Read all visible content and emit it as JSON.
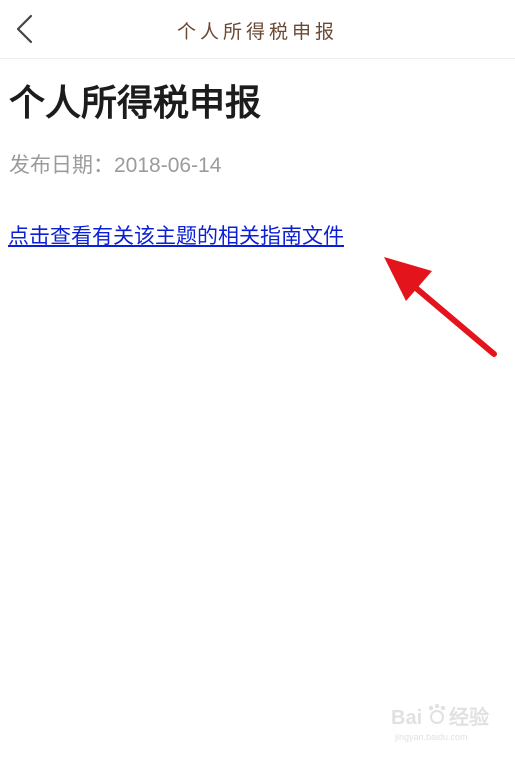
{
  "header": {
    "title": "个人所得税申报",
    "back_icon": "chevron-left-icon"
  },
  "article": {
    "title": "个人所得税申报",
    "date_label": "发布日期：",
    "date_value": "2018-06-14",
    "link_text": "点击查看有关该主题的相关指南文件",
    "link_color": "#0a1fd6"
  },
  "annotation": {
    "arrow_color": "#e3141b"
  },
  "watermark": {
    "brand": "Bai",
    "suffix": "经验",
    "url": "jingyan.baidu.com"
  }
}
